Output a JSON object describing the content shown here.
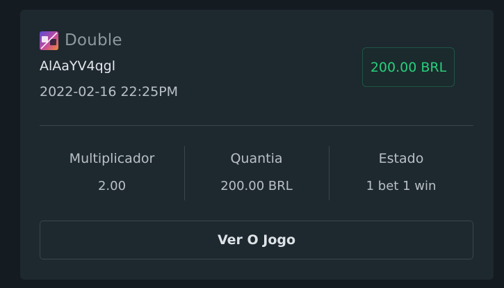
{
  "bet": {
    "game_icon": "double-game-icon",
    "game_name": "Double",
    "id": "AlAaYV4qgl",
    "date": "2022-02-16 22:25PM",
    "amount_badge": "200.00 BRL"
  },
  "stats": [
    {
      "label": "Multiplicador",
      "value": "2.00"
    },
    {
      "label": "Quantia",
      "value": "200.00 BRL"
    },
    {
      "label": "Estado",
      "value": "1 bet 1 win"
    }
  ],
  "actions": {
    "view_game_label": "Ver O Jogo"
  },
  "colors": {
    "page_background": "#141b21",
    "card_background": "#1e282f",
    "accent_green": "#28d07d",
    "muted_text": "#8e989f",
    "divider": "#3a454d"
  }
}
